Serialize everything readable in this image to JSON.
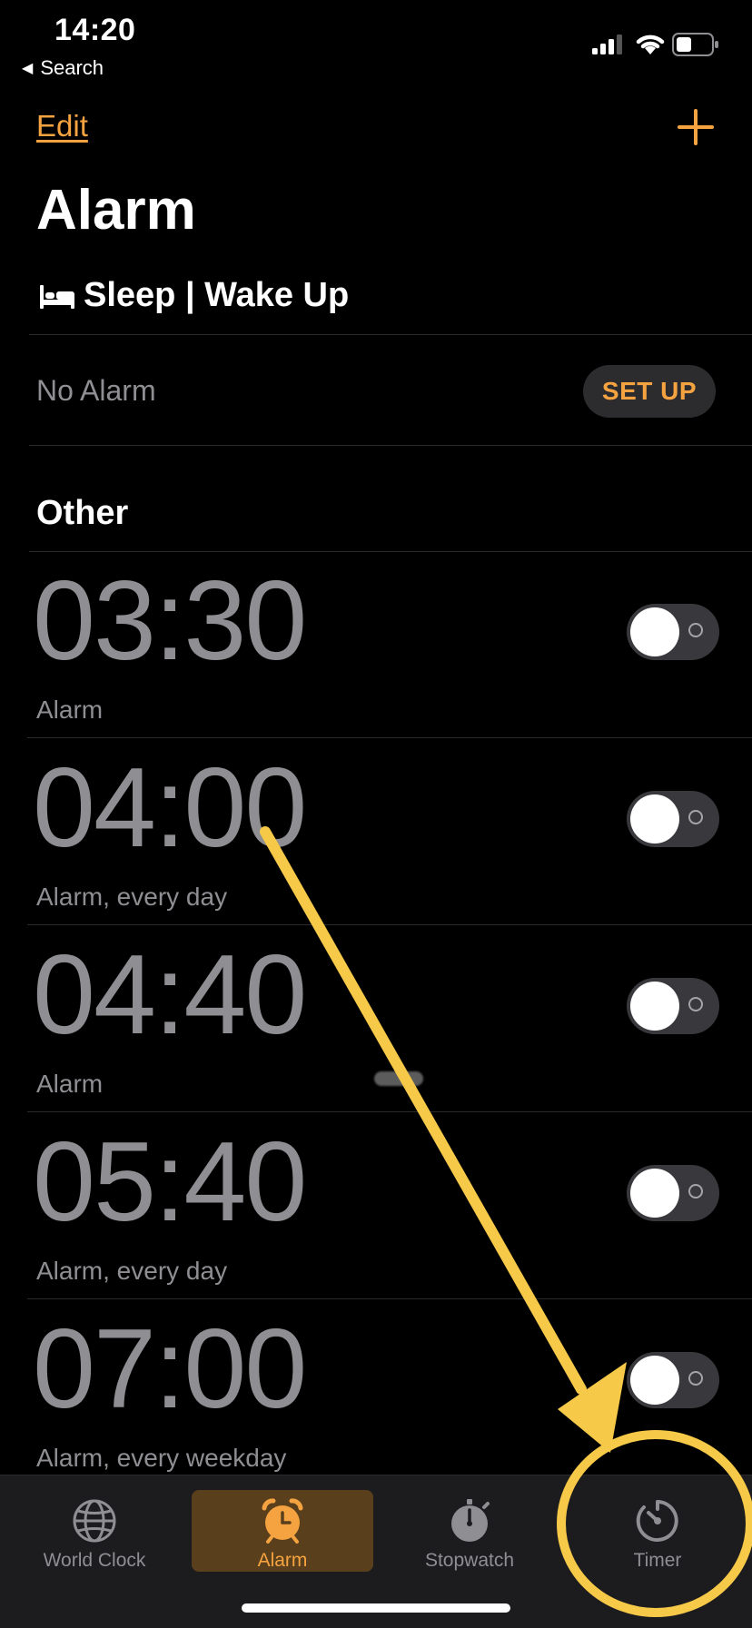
{
  "status_bar": {
    "time": "14:20",
    "back_label": "Search"
  },
  "nav": {
    "edit_label": "Edit"
  },
  "page_title": "Alarm",
  "sleep": {
    "title": "Sleep | Wake Up",
    "no_alarm": "No Alarm",
    "setup_label": "SET UP"
  },
  "section_title": "Other",
  "alarms": [
    {
      "time": "03:30",
      "label": "Alarm",
      "enabled": false
    },
    {
      "time": "04:00",
      "label": "Alarm, every day",
      "enabled": false
    },
    {
      "time": "04:40",
      "label": "Alarm",
      "enabled": false
    },
    {
      "time": "05:40",
      "label": "Alarm, every day",
      "enabled": false
    },
    {
      "time": "07:00",
      "label": "Alarm, every weekday",
      "enabled": false
    }
  ],
  "tabs": [
    {
      "label": "World Clock",
      "icon": "globe-icon",
      "active": false
    },
    {
      "label": "Alarm",
      "icon": "alarm-clock-icon",
      "active": true
    },
    {
      "label": "Stopwatch",
      "icon": "stopwatch-icon",
      "active": false
    },
    {
      "label": "Timer",
      "icon": "timer-icon",
      "active": false
    }
  ],
  "colors": {
    "accent": "#f5a340",
    "annotation": "#f7c948",
    "background": "#000000",
    "muted_text": "#8e8e93"
  }
}
